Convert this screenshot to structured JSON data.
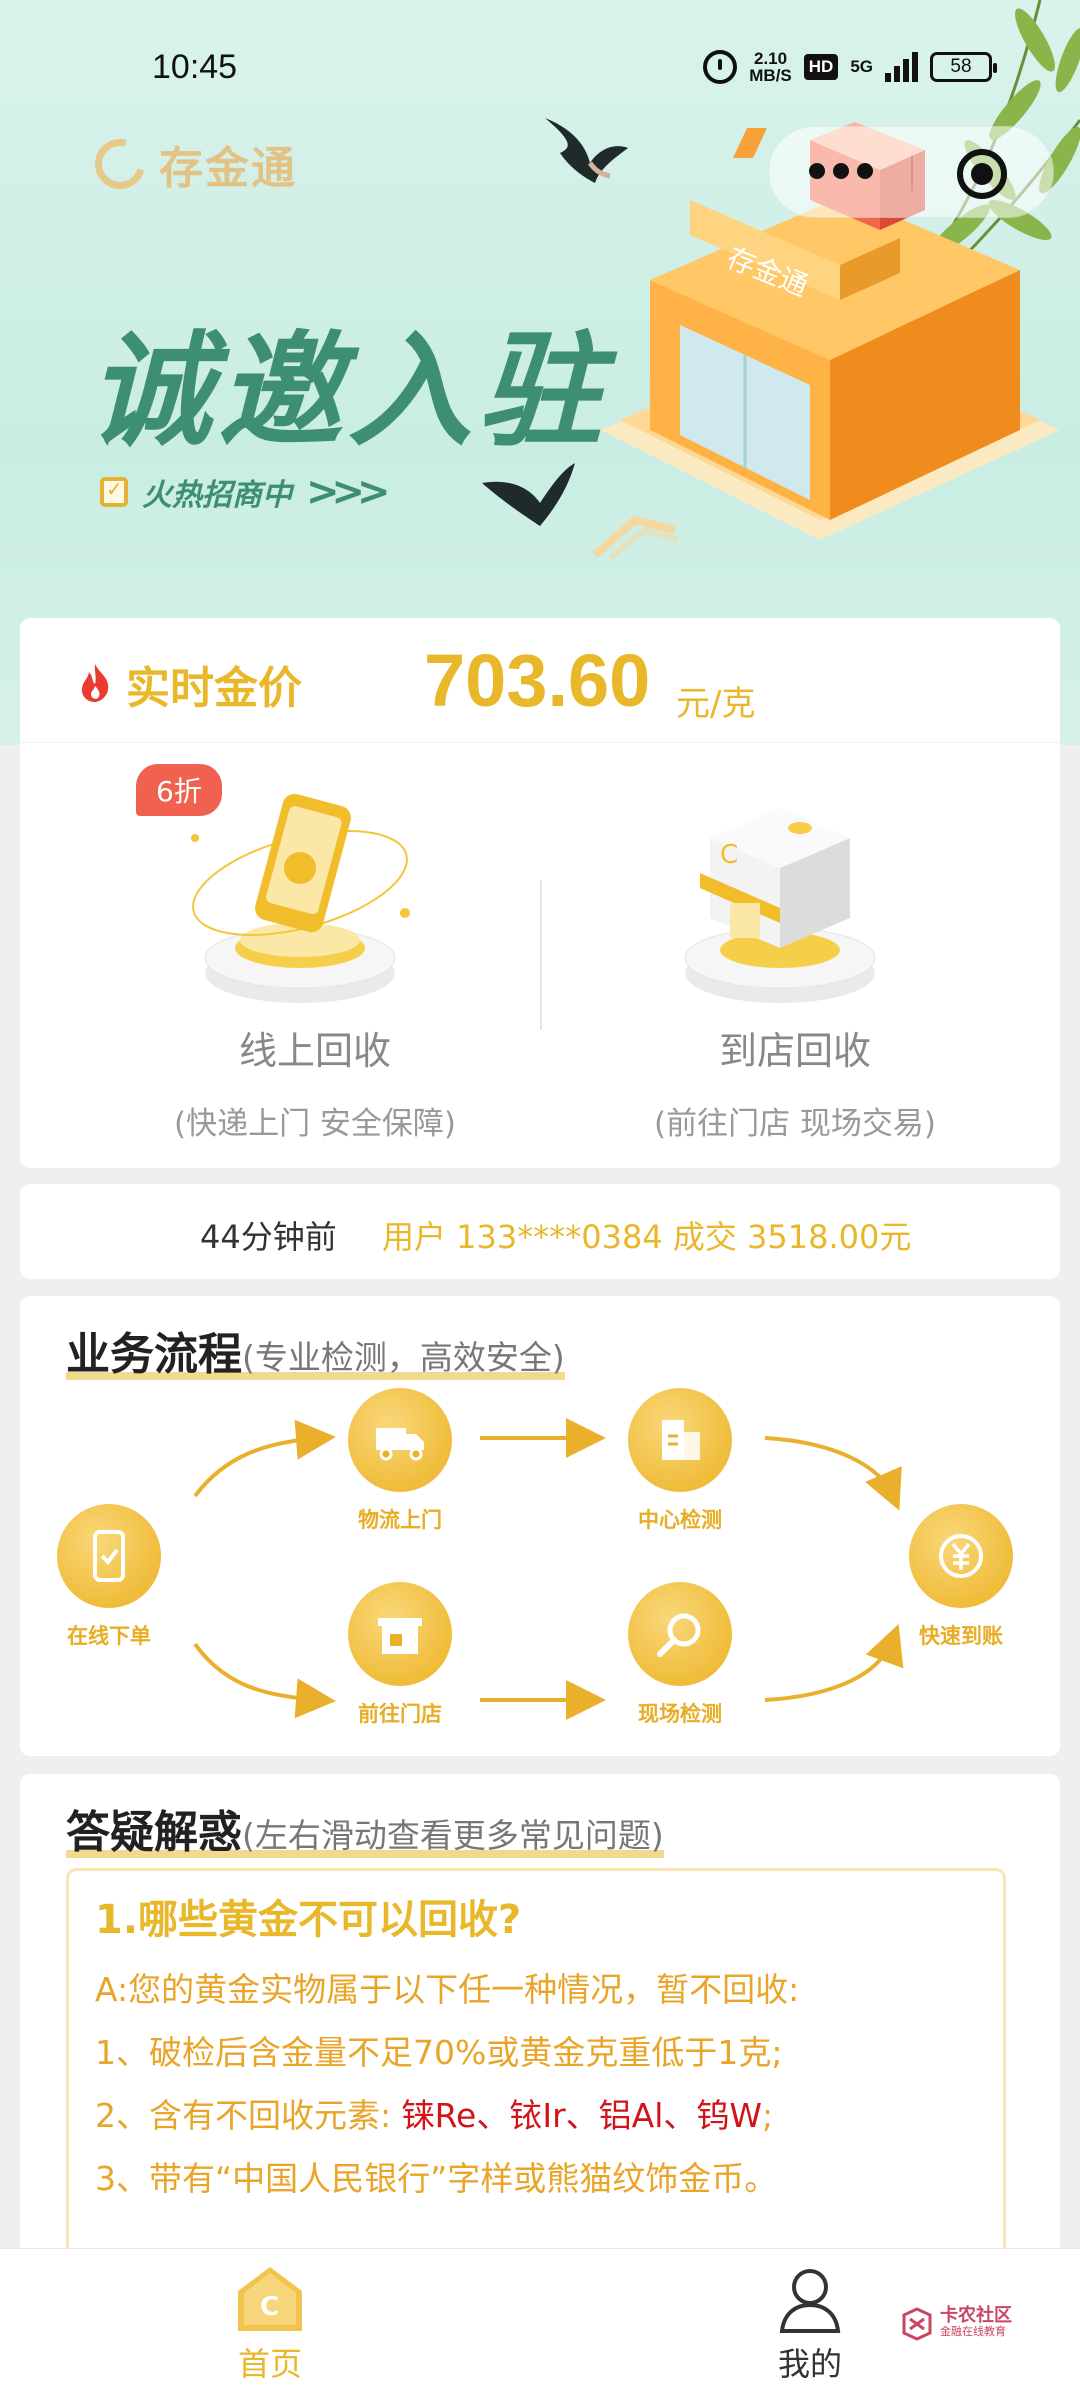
{
  "status_bar": {
    "time": "10:45",
    "net_speed_value": "2.10",
    "net_speed_unit": "MB/S",
    "hd": "HD",
    "signal": "5G",
    "battery": "58"
  },
  "banner": {
    "brand": "存金通",
    "title": "诚邀入驻",
    "subtitle": "火热招商中",
    "shop_sign": "存金通"
  },
  "gold_price": {
    "label": "实时金价",
    "value": "703.60",
    "unit": "元/克"
  },
  "recycle_options": [
    {
      "badge": "6折",
      "title": "线上回收",
      "subtitle": "(快递上门 安全保障)"
    },
    {
      "title": "到店回收",
      "subtitle": "(前往门店 现场交易)"
    }
  ],
  "ticker": {
    "time": "44分钟前",
    "text": "用户 133****0384 成交 3518.00元"
  },
  "process": {
    "title": "业务流程",
    "subtitle": "(专业检测，高效安全)",
    "steps": {
      "order": "在线下单",
      "logistics": "物流上门",
      "center_check": "中心检测",
      "store": "前往门店",
      "onsite_check": "现场检测",
      "payout": "快速到账"
    }
  },
  "faq": {
    "title": "答疑解惑",
    "subtitle": "(左右滑动查看更多常见问题)",
    "question": "1.哪些黄金不可以回收?",
    "answer_intro": "A:您的黄金实物属于以下任一种情况，暂不回收:",
    "item1": "1、破检后含金量不足70%或黄金克重低于1克;",
    "item2_prefix": "2、含有不回收元素: ",
    "item2_elements": "铼Re、铱Ir、铝Al、钨W",
    "item2_suffix": ";",
    "item3": "3、带有“中国人民银行”字样或熊猫纹饰金币。"
  },
  "tab_bar": {
    "home": "首页",
    "mine": "我的",
    "home_icon_letter": "C"
  },
  "watermark": {
    "main": "卡农社区",
    "sub": "金融在线教育"
  },
  "colors": {
    "gold": "#e8b72a",
    "banner_green": "#3d8e72",
    "banner_bg": "#d9f3ec",
    "badge_red": "#f0624f",
    "warning_red": "#d0141a"
  }
}
